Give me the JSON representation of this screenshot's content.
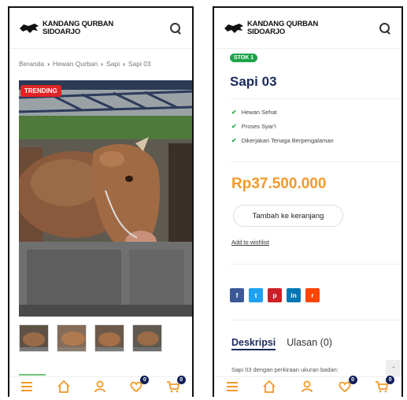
{
  "left": {
    "logo_line1": "KANDANG QURBAN",
    "logo_line2": "SIDOARJO",
    "breadcrumb": [
      "Beranda",
      "Hewan Qurban",
      "Sapi",
      "Sapi 03"
    ],
    "badge": "TRENDING"
  },
  "right": {
    "logo_line1": "KANDANG QURBAN",
    "logo_line2": "SIDOARJO",
    "stock": "STOK 1",
    "title": "Sapi 03",
    "features": [
      "Hewan Sehat",
      "Proses Syar'i",
      "Dikerjakan Tenaga Berpengalaman"
    ],
    "price": "Rp37.500.000",
    "cart_button": "Tambah ke keranjang",
    "wishlist": "Add to wishlist",
    "share": [
      {
        "icon": "facebook-icon",
        "glyph": "f",
        "color": "#3b5998"
      },
      {
        "icon": "twitter-icon",
        "glyph": "t",
        "color": "#1da1f2"
      },
      {
        "icon": "pinterest-icon",
        "glyph": "p",
        "color": "#cb2027"
      },
      {
        "icon": "linkedin-icon",
        "glyph": "in",
        "color": "#0077b5"
      },
      {
        "icon": "reddit-icon",
        "glyph": "r",
        "color": "#ff4500"
      }
    ],
    "tab_active": "Deskripsi",
    "tab_inactive": "Ulasan (0)",
    "description": "Sapi 03 dengan perkiraan ukuran badan:"
  },
  "nav": {
    "wishlist_count": "0",
    "cart_count": "0",
    "accent": "#f19a2a"
  }
}
